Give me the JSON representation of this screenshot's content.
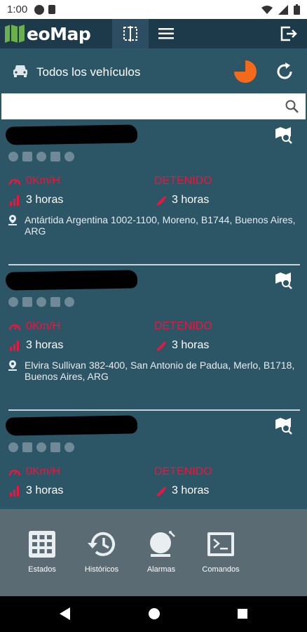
{
  "status_bar": {
    "time": "1:00"
  },
  "app": {
    "logo_text": "eoMap"
  },
  "selector": {
    "label": "Todos los vehículos"
  },
  "search": {
    "value": "",
    "placeholder": ""
  },
  "vehicles": [
    {
      "speed": "0Km/H",
      "state": "DETENIDO",
      "time_a": "3 horas",
      "time_b": "3 horas",
      "address": "Antártida Argentina 1002-1100, Moreno, B1744, Buenos Aires, ARG"
    },
    {
      "speed": "0Km/H",
      "state": "DETENIDO",
      "time_a": "3 horas",
      "time_b": "3 horas",
      "address": "Elvira Sullivan 382-400, San Antonio de Padua, Merlo, B1718, Buenos Aires, ARG"
    },
    {
      "speed": "0Km/H",
      "state": "DETENIDO",
      "time_a": "3 horas",
      "time_b": "3 horas",
      "address": ""
    }
  ],
  "dock": {
    "estados": "Estados",
    "historicos": "Históricos",
    "alarmas": "Alarmas",
    "comandos": "Comandos"
  },
  "colors": {
    "accent_red": "#e8173f",
    "orange": "#f26b1d",
    "primary": "#2c5566"
  }
}
